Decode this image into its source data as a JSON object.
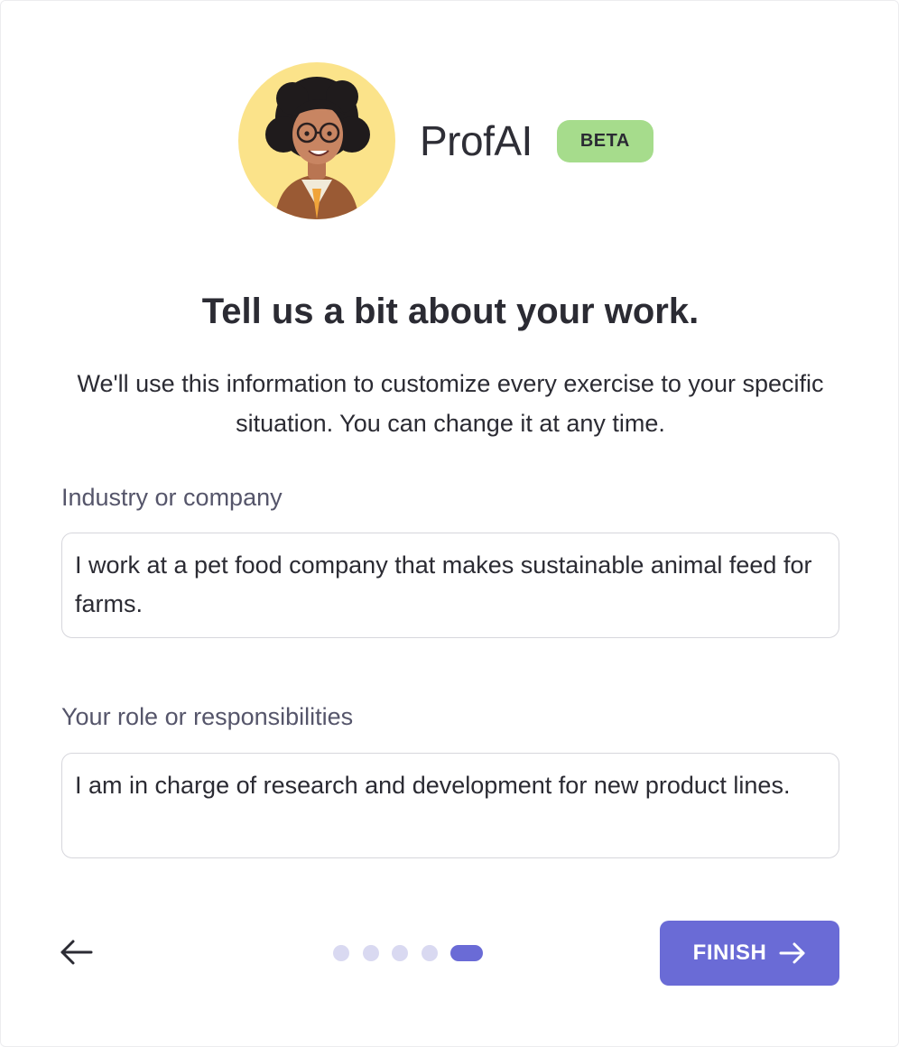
{
  "brand": {
    "name": "ProfAI",
    "badge": "BETA",
    "avatar_icon": "teacher-avatar-illustration"
  },
  "heading": {
    "title": "Tell us a bit about your work.",
    "subtitle": "We'll use this information to customize every exercise to your specific situation. You can change it at any time."
  },
  "fields": {
    "industry": {
      "label": "Industry or company",
      "value": "I work at a pet food company that makes sustainable animal feed for farms."
    },
    "role": {
      "label": "Your role or responsibilities",
      "value": "I am in charge of research and development for new product lines."
    }
  },
  "footer": {
    "back_icon": "arrow-left-icon",
    "steps_total": 5,
    "current_step": 5,
    "finish_label": "FINISH",
    "finish_icon": "arrow-right-icon"
  },
  "colors": {
    "accent": "#6a6bd6",
    "badge": "#a6dc8c",
    "avatar_bg": "#fbe38a",
    "inactive_dot": "#d9d9f1"
  }
}
